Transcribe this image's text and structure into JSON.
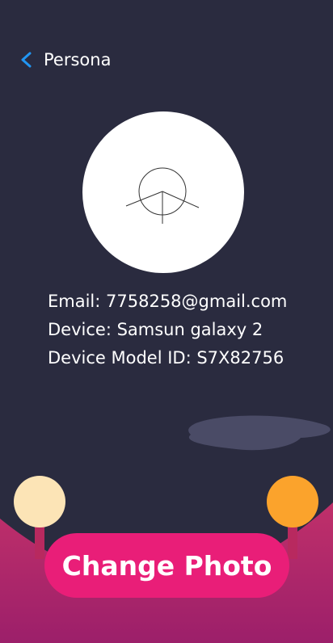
{
  "header": {
    "back_icon": "chevron-left-icon",
    "title": "Persona"
  },
  "profile": {
    "avatar_icon": "placeholder-person-icon",
    "email_line": "Email: 7758258@gmail.com",
    "device_line": "Device: Samsun galaxy 2",
    "model_line": "Device Model ID: S7X82756"
  },
  "action": {
    "change_photo_label": "Change Photo"
  },
  "colors": {
    "background": "#2a2b3f",
    "accent_blue": "#2196f3",
    "button_pink": "#e91e78",
    "ground": "#b8295f",
    "lamp_left": "#fce4b6",
    "lamp_right": "#fba32c"
  }
}
